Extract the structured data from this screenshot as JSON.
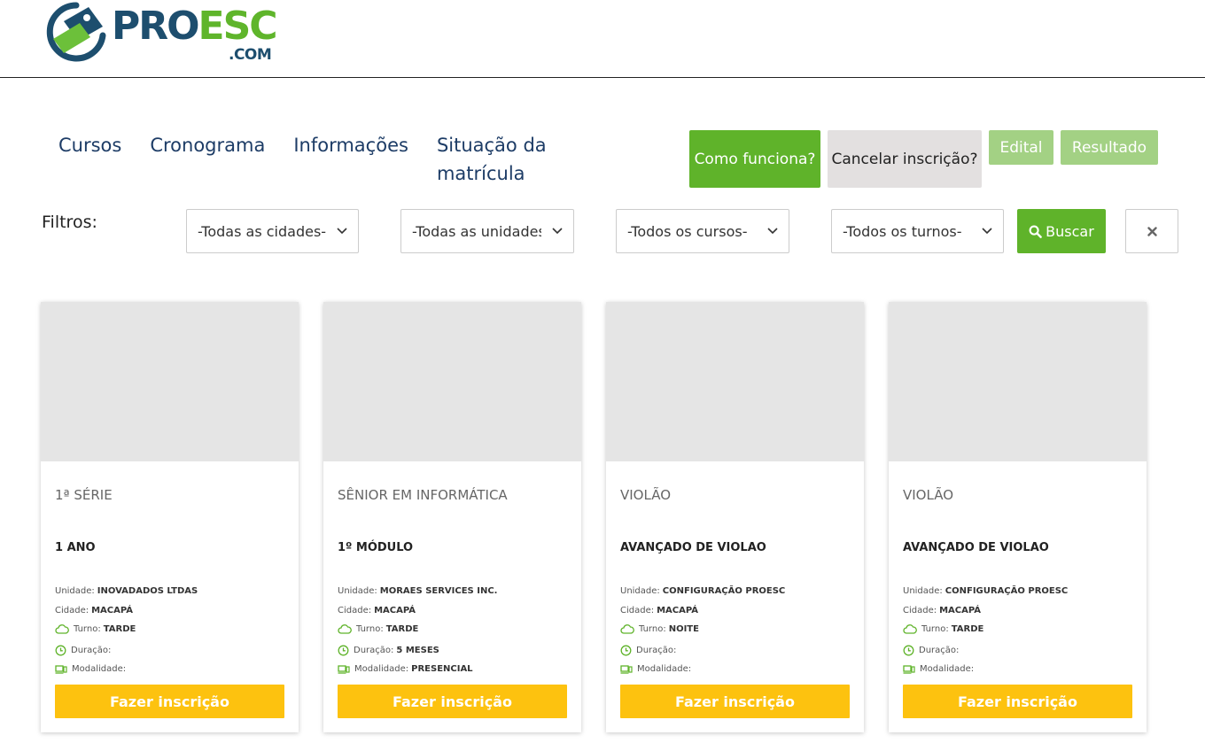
{
  "brand": {
    "part1": "PRO",
    "part2": "ESC",
    "domain": ".COM"
  },
  "nav": [
    {
      "label": "Cursos"
    },
    {
      "label": "Cronograma"
    },
    {
      "label": "Informações"
    },
    {
      "label": "Situação da matrícula"
    }
  ],
  "actions": {
    "como": "Como funciona?",
    "cancel": "Cancelar inscrição?",
    "edital": "Edital",
    "resultado": "Resultado"
  },
  "filters": {
    "label": "Filtros:",
    "city": "-Todas as cidades-",
    "unit": "-Todas as unidades-",
    "course": "-Todos os cursos-",
    "shift": "-Todos os turnos-",
    "search": "Buscar"
  },
  "labels": {
    "unidade": "Unidade:",
    "cidade": "Cidade:",
    "turno": "Turno:",
    "duracao": "Duração:",
    "modalidade": "Modalidade:",
    "enroll": "Fazer inscrição"
  },
  "cards": [
    {
      "title": "1ª SÉRIE",
      "sub": "1 ANO",
      "unidade": "INOVADADOS LTDAS",
      "cidade": "MACAPÁ",
      "turno": "TARDE",
      "duracao": "",
      "modalidade": ""
    },
    {
      "title": "SÊNIOR EM INFORMÁTICA",
      "sub": "1º MÓDULO",
      "unidade": "MORAES SERVICES INC.",
      "cidade": "MACAPÁ",
      "turno": "TARDE",
      "duracao": "5 MESES",
      "modalidade": "PRESENCIAL"
    },
    {
      "title": "VIOLÃO",
      "sub": "AVANÇADO DE VIOLAO",
      "unidade": "CONFIGURAÇÃO PROESC",
      "cidade": "MACAPÁ",
      "turno": "NOITE",
      "duracao": "",
      "modalidade": ""
    },
    {
      "title": "VIOLÃO",
      "sub": "AVANÇADO DE VIOLAO",
      "unidade": "CONFIGURAÇÃO PROESC",
      "cidade": "MACAPÁ",
      "turno": "TARDE",
      "duracao": "",
      "modalidade": ""
    }
  ],
  "colors": {
    "green": "#5fb32a",
    "light_green": "#a3d184",
    "navy": "#1d3c66",
    "yellow": "#fdc20f"
  }
}
